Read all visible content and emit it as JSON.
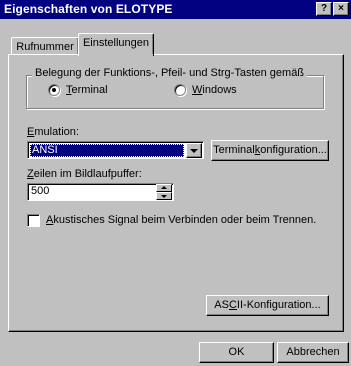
{
  "window": {
    "title": "Eigenschaften von ELOTYPE",
    "help_label": "?",
    "close_label": "×"
  },
  "tabs": [
    {
      "label": "Rufnummer",
      "active": false
    },
    {
      "label": "Einstellungen",
      "active": true
    }
  ],
  "keys_group": {
    "label": "Belegung der Funktions-, Pfeil- und Strg-Tasten gemäß",
    "options": [
      {
        "label": "Terminal",
        "mnemonic": "T",
        "rest": "erminal",
        "selected": true
      },
      {
        "label": "Windows",
        "mnemonic": "W",
        "rest": "indows",
        "selected": false
      }
    ]
  },
  "emulation": {
    "label": "Emulation:",
    "mnemonic": "E",
    "rest": "mulation:",
    "value": "ANSI"
  },
  "terminal_config_button": {
    "label": "Terminalkonfiguration...",
    "pre": "Terminal",
    "mnemonic": "k",
    "post": "onfiguration..."
  },
  "scrollback": {
    "label": "Zeilen im Bildlaufpuffer:",
    "mnemonic": "Z",
    "rest": "eilen im Bildlaufpuffer:",
    "value": "500"
  },
  "sound_checkbox": {
    "label": "Akustisches Signal beim Verbinden oder beim Trennen.",
    "mnemonic": "A",
    "rest": "kustisches Signal beim Verbinden oder beim Trennen.",
    "checked": false
  },
  "ascii_config_button": {
    "label": "ASCII-Konfiguration...",
    "pre": "AS",
    "mnemonic": "C",
    "post": "II-Konfiguration..."
  },
  "footer": {
    "ok_label": "OK",
    "cancel_label": "Abbrechen"
  },
  "colors": {
    "title_bar": "#000080",
    "face": "#c0c0c0",
    "selection": "#000080"
  }
}
